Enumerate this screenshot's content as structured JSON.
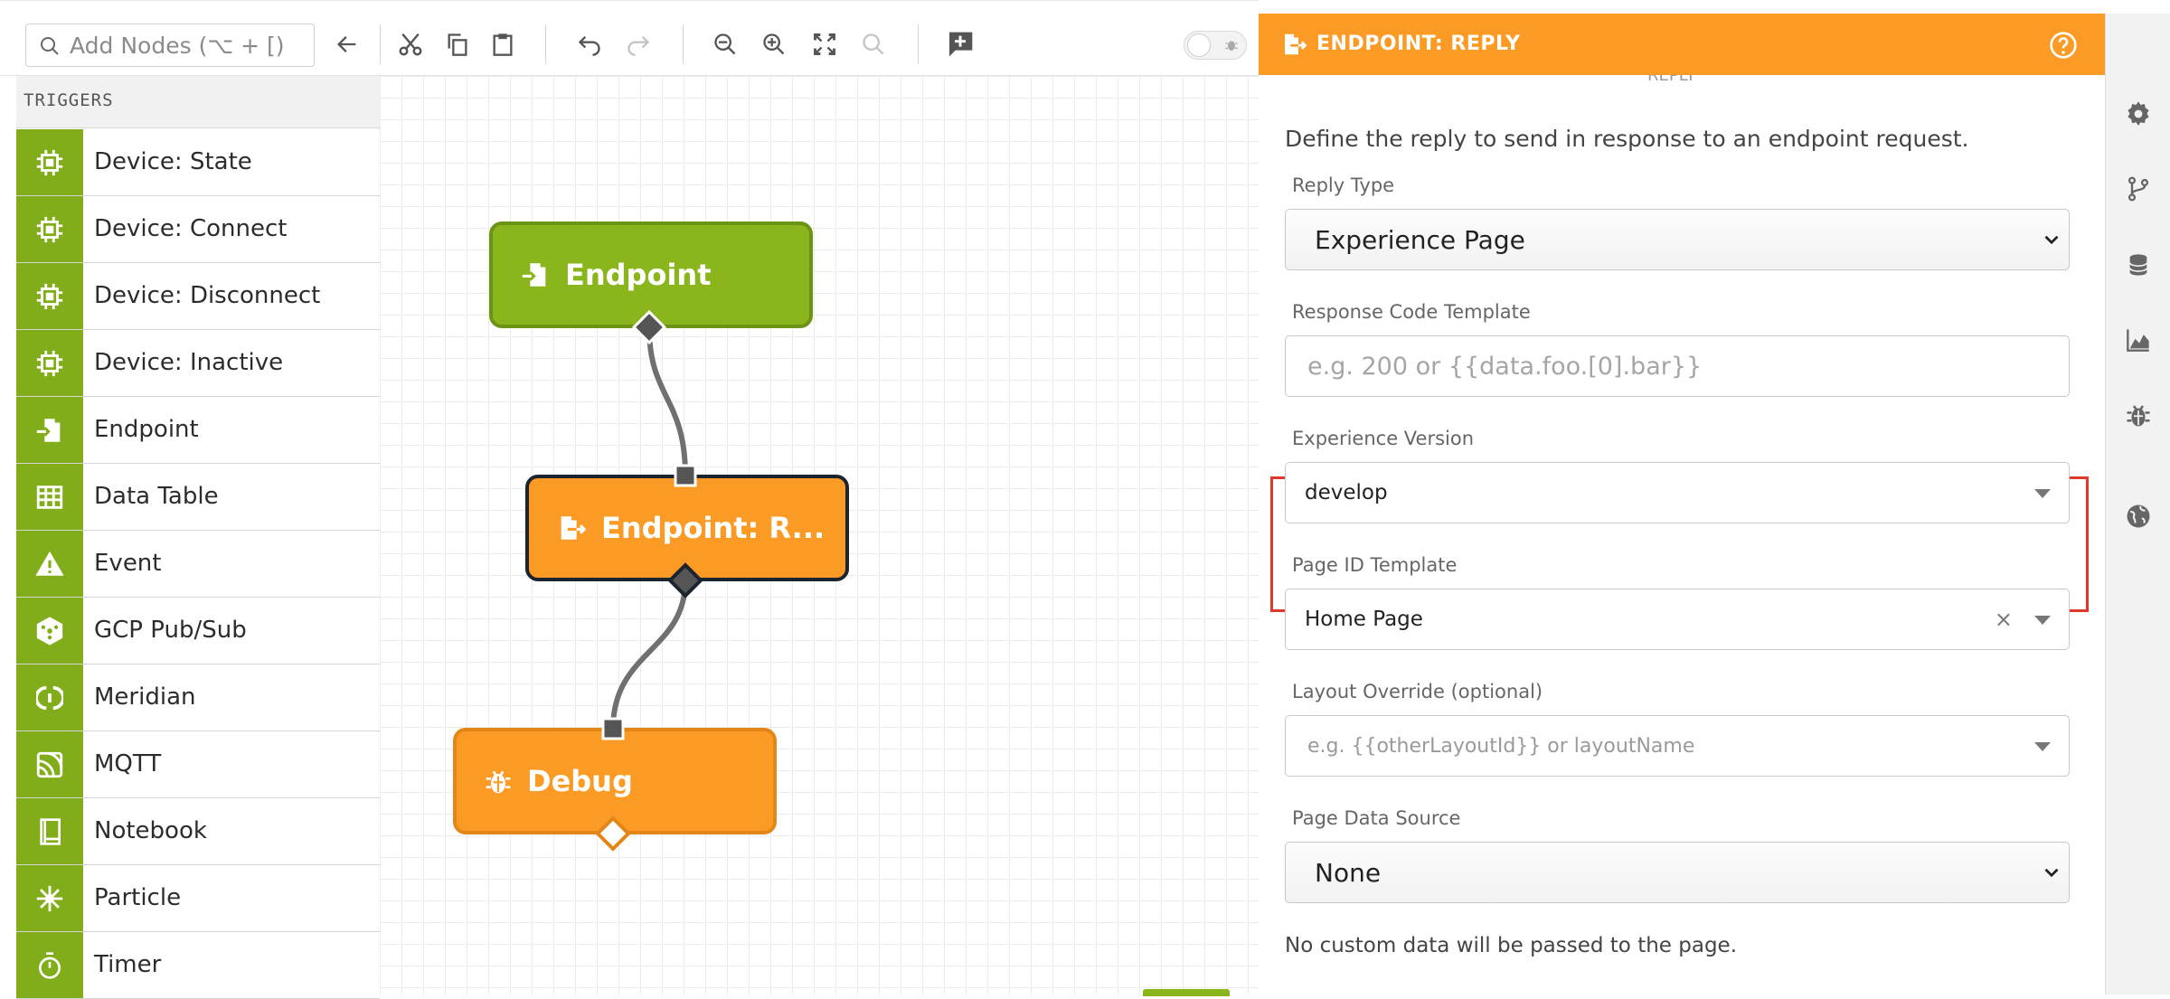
{
  "toolbar": {
    "search_placeholder": "Add Nodes (⌥ + [)",
    "icons": [
      "search-icon",
      "back-arrow-icon",
      "cut-icon",
      "copy-icon",
      "paste-icon",
      "undo-icon",
      "redo-icon",
      "zoom-out-icon",
      "zoom-in-icon",
      "fit-screen-icon",
      "zoom-reset-icon",
      "add-comment-icon",
      "debug-toggle"
    ]
  },
  "palette": {
    "header": "TRIGGERS",
    "items": [
      {
        "label": "Device: State",
        "icon": "chip-icon"
      },
      {
        "label": "Device: Connect",
        "icon": "chip-icon"
      },
      {
        "label": "Device: Disconnect",
        "icon": "chip-icon"
      },
      {
        "label": "Device: Inactive",
        "icon": "chip-icon"
      },
      {
        "label": "Endpoint",
        "icon": "endpoint-icon"
      },
      {
        "label": "Data Table",
        "icon": "table-icon"
      },
      {
        "label": "Event",
        "icon": "warning-icon"
      },
      {
        "label": "GCP Pub/Sub",
        "icon": "gcp-icon"
      },
      {
        "label": "Meridian",
        "icon": "meridian-icon"
      },
      {
        "label": "MQTT",
        "icon": "mqtt-icon"
      },
      {
        "label": "Notebook",
        "icon": "notebook-icon"
      },
      {
        "label": "Particle",
        "icon": "particle-icon"
      },
      {
        "label": "Timer",
        "icon": "timer-icon"
      }
    ]
  },
  "canvas": {
    "nodes": [
      {
        "label": "Endpoint",
        "color": "#8ab51c"
      },
      {
        "label": "Endpoint: R...",
        "color": "#fb9b26"
      },
      {
        "label": "Debug",
        "color": "#fb9b26"
      }
    ]
  },
  "panel": {
    "title": "ENDPOINT: REPLY",
    "cut_heading": "REPLY",
    "description": "Define the reply to send in response to an endpoint request.",
    "fields": {
      "reply_type": {
        "label": "Reply Type",
        "value": "Experience Page"
      },
      "response_code": {
        "label": "Response Code Template",
        "placeholder": "e.g. 200 or {{data.foo.[0].bar}}"
      },
      "experience_version": {
        "label": "Experience Version",
        "value": "develop"
      },
      "page_id": {
        "label": "Page ID Template",
        "value": "Home Page"
      },
      "layout_override": {
        "label": "Layout Override (optional)",
        "placeholder": "e.g. {{otherLayoutId}} or layoutName"
      },
      "page_data_source": {
        "label": "Page Data Source",
        "value": "None"
      }
    },
    "footnote": "No custom data will be passed to the page."
  },
  "side_icons": [
    "gear-icon",
    "branch-icon",
    "database-icon",
    "chart-icon",
    "bug-icon",
    "globe-icon"
  ],
  "colors": {
    "accent_orange": "#fb9b26",
    "palette_green": "#82ad1a",
    "highlight_red": "#e0382b"
  }
}
